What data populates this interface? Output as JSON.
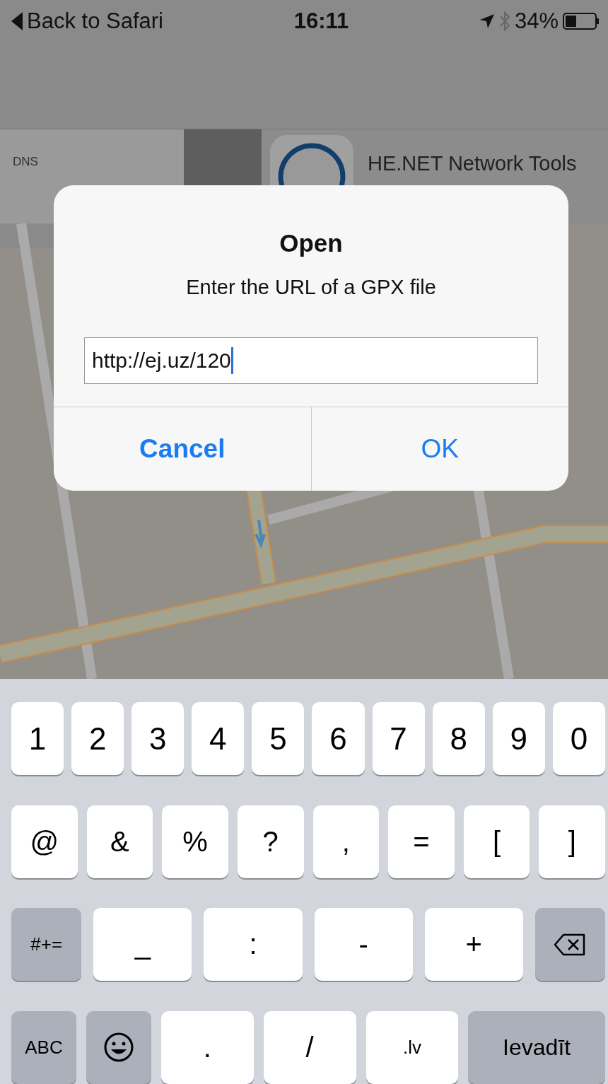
{
  "status_bar": {
    "back": "Back to Safari",
    "time": "16:11",
    "battery": "34%"
  },
  "background": {
    "list_items": [
      "DNS"
    ],
    "ad": {
      "title": "HE.NET Network Tools"
    }
  },
  "dialog": {
    "title": "Open",
    "message": "Enter the URL of a GPX file",
    "field": {
      "value": "http://ej.uz/120"
    },
    "buttons": [
      {
        "label": "Cancel",
        "kind": "cancel"
      },
      {
        "label": "OK",
        "kind": "default"
      }
    ]
  },
  "keyboard": {
    "rows": [
      {
        "keys": [
          {
            "label": "1",
            "kind": "char"
          },
          {
            "label": "2",
            "kind": "char"
          },
          {
            "label": "3",
            "kind": "char"
          },
          {
            "label": "4",
            "kind": "char"
          },
          {
            "label": "5",
            "kind": "char"
          },
          {
            "label": "6",
            "kind": "char"
          },
          {
            "label": "7",
            "kind": "char"
          },
          {
            "label": "8",
            "kind": "char"
          },
          {
            "label": "9",
            "kind": "char"
          },
          {
            "label": "0",
            "kind": "char"
          }
        ]
      },
      {
        "keys": [
          {
            "label": "@",
            "kind": "char"
          },
          {
            "label": "&",
            "kind": "char"
          },
          {
            "label": "%",
            "kind": "char"
          },
          {
            "label": "?",
            "kind": "char"
          },
          {
            "label": ",",
            "kind": "char"
          },
          {
            "label": "=",
            "kind": "char"
          },
          {
            "label": "[",
            "kind": "char"
          },
          {
            "label": "]",
            "kind": "char"
          }
        ]
      },
      {
        "keys": [
          {
            "label": "#+=",
            "kind": "function"
          },
          {
            "label": "_",
            "kind": "char"
          },
          {
            "label": ":",
            "kind": "char"
          },
          {
            "label": "-",
            "kind": "char"
          },
          {
            "label": "+",
            "kind": "char"
          },
          {
            "kind": "delete"
          }
        ]
      },
      {
        "keys": [
          {
            "label": "ABC",
            "kind": "function"
          },
          {
            "kind": "emoji"
          },
          {
            "label": ".",
            "kind": "char"
          },
          {
            "label": "/",
            "kind": "char"
          },
          {
            "label": ".lv",
            "kind": "small"
          },
          {
            "label": "Ievadīt",
            "kind": "return"
          }
        ]
      }
    ]
  }
}
